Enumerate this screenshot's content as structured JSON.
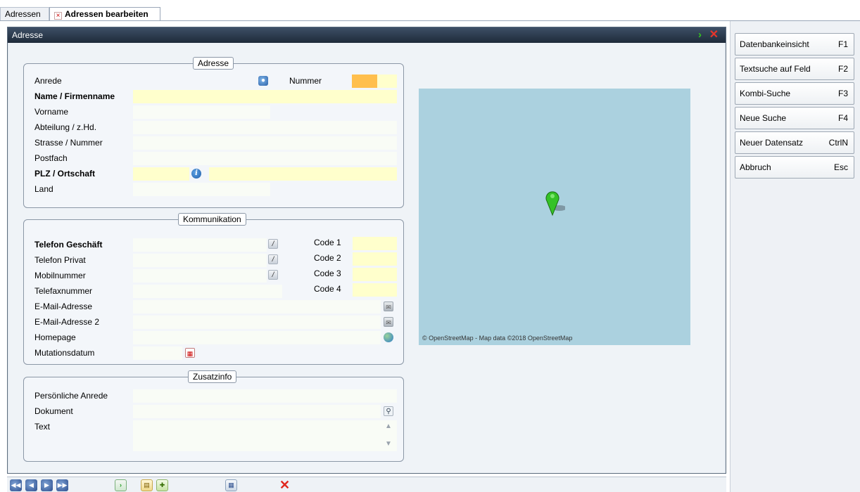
{
  "tabs": [
    {
      "label": "Adressen"
    },
    {
      "label": "Adressen bearbeiten",
      "close_glyph": "×"
    }
  ],
  "window": {
    "title": "Adresse",
    "go_glyph": "›",
    "close_glyph": "✕"
  },
  "adresse": {
    "legend": "Adresse",
    "anrede": "Anrede",
    "nummer": "Nummer",
    "name": "Name / Firmenname",
    "vorname": "Vorname",
    "abteilung": "Abteilung / z.Hd.",
    "strasse": "Strasse / Nummer",
    "postfach": "Postfach",
    "plz": "PLZ / Ortschaft",
    "land": "Land"
  },
  "kommunikation": {
    "legend": "Kommunikation",
    "telefon_geschaeft": "Telefon Geschäft",
    "telefon_privat": "Telefon Privat",
    "mobil": "Mobilnummer",
    "fax": "Telefaxnummer",
    "email": "E-Mail-Adresse",
    "email2": "E-Mail-Adresse 2",
    "homepage": "Homepage",
    "mutation": "Mutationsdatum",
    "code1": "Code 1",
    "code2": "Code 2",
    "code3": "Code 3",
    "code4": "Code 4"
  },
  "zusatz": {
    "legend": "Zusatzinfo",
    "anrede": "Persönliche Anrede",
    "dokument": "Dokument",
    "text": "Text"
  },
  "map": {
    "attribution": "© OpenStreetMap - Map data ©2018 OpenStreetMap"
  },
  "side_buttons": [
    {
      "label": "Datenbankeinsicht",
      "key": "F1"
    },
    {
      "label": "Textsuche auf Feld",
      "key": "F2"
    },
    {
      "label": "Kombi-Suche",
      "key": "F3"
    },
    {
      "label": "Neue Suche",
      "key": "F4"
    },
    {
      "label": "Neuer Datensatz",
      "key": "CtrlN"
    },
    {
      "label": "Abbruch",
      "key": "Esc"
    }
  ],
  "colors": {
    "accent_title": "#1f2b3a",
    "required_field": "#ffffcc",
    "number_field": "#ffbf4d",
    "map_bg": "#abd1df",
    "pin": "#35c227"
  },
  "icons": {
    "bottom_toolbar": [
      "first-record-icon",
      "previous-record-icon",
      "next-record-icon",
      "last-record-icon",
      "go-icon",
      "document-icon",
      "new-document-icon",
      "grid-icon",
      "cancel-icon"
    ]
  }
}
